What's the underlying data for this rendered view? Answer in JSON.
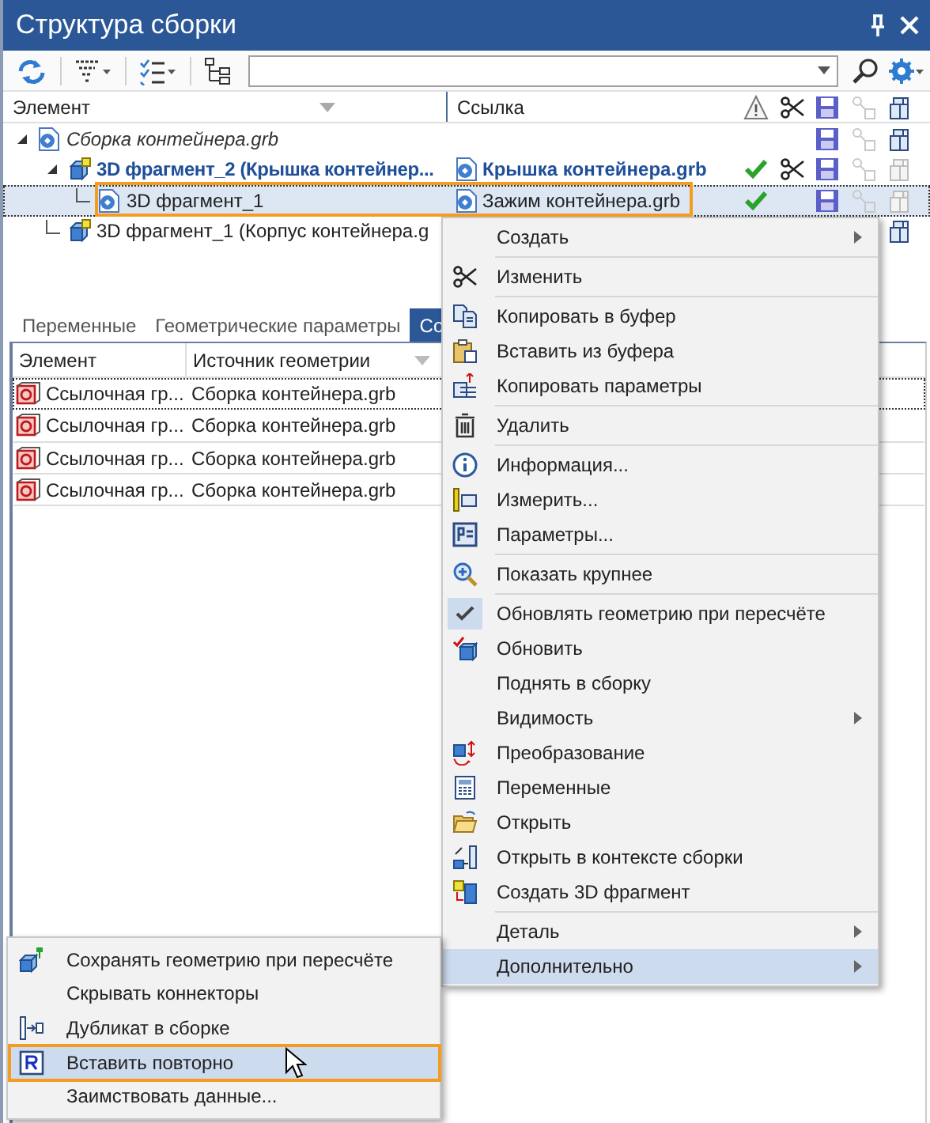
{
  "window": {
    "title": "Структура сборки"
  },
  "tree": {
    "columns": [
      "Элемент",
      "Ссылка"
    ],
    "rows": [
      {
        "label": "Сборка контейнера.grb",
        "kind": "italic",
        "expanded": true,
        "selected": false,
        "highlighted": false,
        "ok": false,
        "edited": false,
        "saved": true,
        "dimmed": false,
        "children": [
          {
            "label": "3D фрагмент_2 (Крышка контейнер...",
            "link": "Крышка контейнера.grb",
            "kind": "bold",
            "expanded": true,
            "selected": false,
            "highlighted": false,
            "ok": true,
            "edited": true,
            "saved": true,
            "dimmed": true,
            "children": [
              {
                "label": "3D фрагмент_1",
                "link": "Зажим контейнера.grb",
                "kind": "plain",
                "selected": true,
                "highlighted": true,
                "ok": true,
                "edited": false,
                "saved": true,
                "dimmed": true
              }
            ]
          },
          {
            "label": "3D фрагмент_1 (Корпус контейнера.g",
            "kind": "plain",
            "selected": false,
            "highlighted": false,
            "ok": false,
            "edited": false,
            "saved": false,
            "dimmed": false
          }
        ]
      }
    ]
  },
  "tabs": [
    {
      "label": "Переменные",
      "selected": false
    },
    {
      "label": "Геометрические параметры",
      "selected": false
    },
    {
      "label": "Со",
      "selected": true
    }
  ],
  "table": {
    "columns": [
      "Элемент",
      "Источник геометрии"
    ],
    "rows": [
      {
        "cells": [
          "Ссылочная гр...",
          "Сборка контейнера.grb"
        ],
        "focused": true
      },
      {
        "cells": [
          "Ссылочная гр...",
          "Сборка контейнера.grb"
        ],
        "focused": false
      },
      {
        "cells": [
          "Ссылочная гр...",
          "Сборка контейнера.grb"
        ],
        "focused": false
      },
      {
        "cells": [
          "Ссылочная гр...",
          "Сборка контейнера.grb"
        ],
        "focused": false
      }
    ]
  },
  "context_menu": {
    "items": [
      {
        "kind": "item",
        "label": "Создать",
        "submenu": true,
        "checked": false,
        "selected": false
      },
      {
        "kind": "separator"
      },
      {
        "kind": "item",
        "label": "Изменить",
        "submenu": false,
        "checked": false,
        "selected": false
      },
      {
        "kind": "separator"
      },
      {
        "kind": "item",
        "label": "Копировать в буфер",
        "submenu": false,
        "checked": false,
        "selected": false
      },
      {
        "kind": "item",
        "label": "Вставить из буфера",
        "submenu": false,
        "checked": false,
        "selected": false
      },
      {
        "kind": "item",
        "label": "Копировать параметры",
        "submenu": false,
        "checked": false,
        "selected": false
      },
      {
        "kind": "separator"
      },
      {
        "kind": "item",
        "label": "Удалить",
        "submenu": false,
        "checked": false,
        "selected": false
      },
      {
        "kind": "separator"
      },
      {
        "kind": "item",
        "label": "Информация...",
        "submenu": false,
        "checked": false,
        "selected": false
      },
      {
        "kind": "item",
        "label": "Измерить...",
        "submenu": false,
        "checked": false,
        "selected": false
      },
      {
        "kind": "item",
        "label": "Параметры...",
        "submenu": false,
        "checked": false,
        "selected": false
      },
      {
        "kind": "separator"
      },
      {
        "kind": "item",
        "label": "Показать крупнее",
        "submenu": false,
        "checked": false,
        "selected": false
      },
      {
        "kind": "separator"
      },
      {
        "kind": "item",
        "label": "Обновлять геометрию при пересчёте",
        "submenu": false,
        "checked": true,
        "selected": false
      },
      {
        "kind": "item",
        "label": "Обновить",
        "submenu": false,
        "checked": false,
        "selected": false
      },
      {
        "kind": "item",
        "label": "Поднять в сборку",
        "submenu": false,
        "checked": false,
        "selected": false
      },
      {
        "kind": "item",
        "label": "Видимость",
        "submenu": true,
        "checked": false,
        "selected": false
      },
      {
        "kind": "item",
        "label": "Преобразование",
        "submenu": false,
        "checked": false,
        "selected": false
      },
      {
        "kind": "item",
        "label": "Переменные",
        "submenu": false,
        "checked": false,
        "selected": false
      },
      {
        "kind": "item",
        "label": "Открыть",
        "submenu": false,
        "checked": false,
        "selected": false
      },
      {
        "kind": "item",
        "label": "Открыть в контексте сборки",
        "submenu": false,
        "checked": false,
        "selected": false
      },
      {
        "kind": "item",
        "label": "Создать 3D фрагмент",
        "submenu": false,
        "checked": false,
        "selected": false
      },
      {
        "kind": "separator"
      },
      {
        "kind": "item",
        "label": "Деталь",
        "submenu": true,
        "checked": false,
        "selected": false
      },
      {
        "kind": "item",
        "label": "Дополнительно",
        "submenu": true,
        "checked": false,
        "selected": true
      }
    ]
  },
  "submenu": {
    "items": [
      {
        "label": "Сохранять геометрию при пересчёте",
        "selected": false,
        "highlighted": false
      },
      {
        "label": "Скрывать коннекторы",
        "selected": false,
        "highlighted": false
      },
      {
        "label": "Дубликат в сборке",
        "selected": false,
        "highlighted": false
      },
      {
        "label": "Вставить повторно",
        "selected": true,
        "highlighted": true
      },
      {
        "label": "Заимствовать данные...",
        "selected": false,
        "highlighted": false
      }
    ]
  }
}
